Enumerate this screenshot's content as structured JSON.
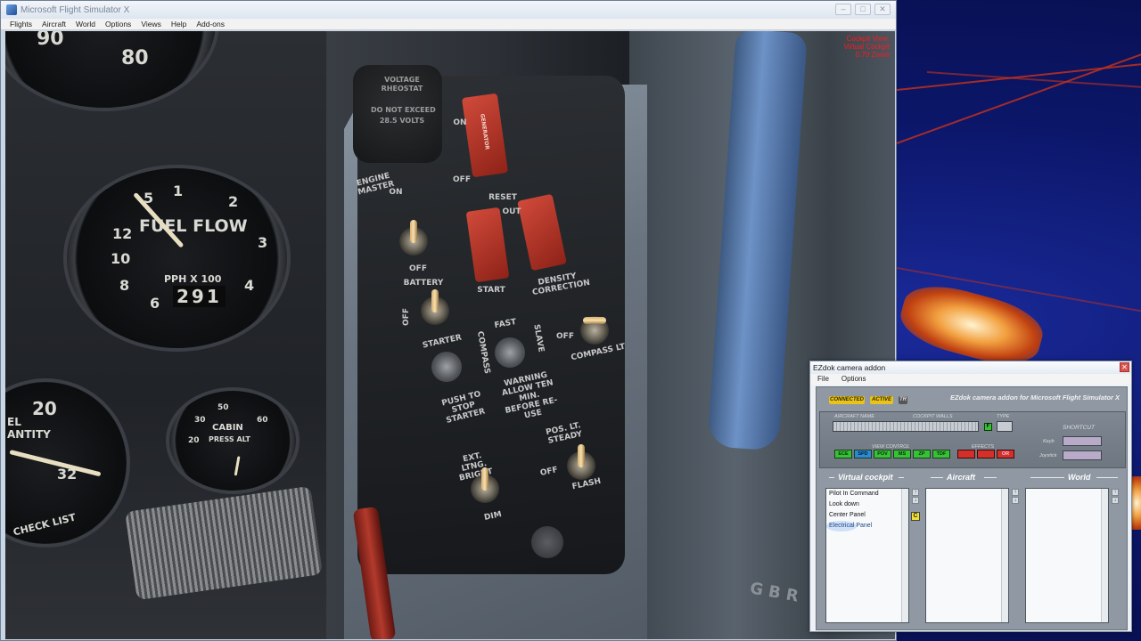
{
  "fsx": {
    "title": "Microsoft Flight Simulator X",
    "window_buttons": [
      "–",
      "□",
      "✕"
    ],
    "menu": [
      "Flights",
      "Aircraft",
      "World",
      "Options",
      "Views",
      "Help",
      "Add-ons"
    ],
    "overlay": [
      "Cockpit View:",
      "Virtual Cockpit",
      "0.70 Zoom"
    ],
    "colors": {
      "overlay": "#ff1a1a",
      "guard_red": "#c8382a"
    }
  },
  "cockpit": {
    "gauge_top_numbers": [
      "90",
      "80"
    ],
    "fuel_flow": {
      "numbers": [
        "5",
        "1",
        "2",
        "3",
        "4",
        "12",
        "10",
        "8",
        "6"
      ],
      "label": "FUEL FLOW",
      "units": "PPH X 100",
      "readout": "291"
    },
    "cabin_gauge": {
      "label": "CABIN",
      "sub": "PRESS ALT",
      "ticks": [
        "50",
        "30",
        "20",
        "60"
      ]
    },
    "quantity_gauge": {
      "numbers": [
        "20",
        "32"
      ],
      "label": "EL ANTITY"
    },
    "voltage_cap": [
      "VOLTAGE",
      "RHEOSTAT",
      "DO NOT EXCEED",
      "28.5 VOLTS"
    ],
    "labels": {
      "engine_master": "ENGINE MASTER",
      "on": "ON",
      "off": "OFF",
      "generator": "GENERATOR",
      "reset": "RESET",
      "out": "OUT",
      "battery": "BATTERY",
      "starter": "STARTER",
      "start": "START",
      "density_correction": "DENSITY CORRECTION",
      "compass": "COMPASS",
      "fast": "FAST",
      "slave": "SLAVE",
      "compass_lt": "COMPASS LT",
      "warning": "WARNING ALLOW TEN MIN. BEFORE RE-USE",
      "push_to_stop": "PUSH TO STOP STARTER",
      "pos_lt": "POS. LT. STEADY",
      "flash": "FLASH",
      "ext_lt": "EXT. LTNG. BRIGHT",
      "dim": "DIM",
      "check_list": "CHECK LIST",
      "gbr": "G B R"
    }
  },
  "ezdok": {
    "title": "EZdok camera addon",
    "menu": [
      "File",
      "Options"
    ],
    "status": {
      "connected": "CONNECTED",
      "active": "ACTIVE",
      "tr": "TR"
    },
    "heading": "EZdok camera addon for Microsoft Flight Simulator X",
    "field_labels": {
      "aircraft_name": "AIRCRAFT NAME",
      "cockpit_walls": "COCKPIT WALLS",
      "type": "TYPE",
      "view_control": "VIEW CONTROL",
      "effects": "EFFECTS",
      "shortcut": "SHORTCUT",
      "keyb": "Keyb",
      "joystick": "Joystick"
    },
    "view_control": [
      "ECE",
      "SPD",
      "POV",
      "MS",
      "ZP",
      "TDF"
    ],
    "effects": [
      "",
      "",
      "OR"
    ],
    "columns": {
      "virtual_cockpit": {
        "title": "Virtual cockpit",
        "items": [
          "Pilot In Command",
          "Look down",
          "Center Panel",
          "Electrical Panel"
        ],
        "selected": 3
      },
      "aircraft": {
        "title": "Aircraft",
        "items": []
      },
      "world": {
        "title": "World",
        "items": []
      }
    },
    "c_button": "C",
    "colors": {
      "green": "#35c235",
      "red": "#d3302a",
      "yellow": "#f2e030"
    }
  }
}
